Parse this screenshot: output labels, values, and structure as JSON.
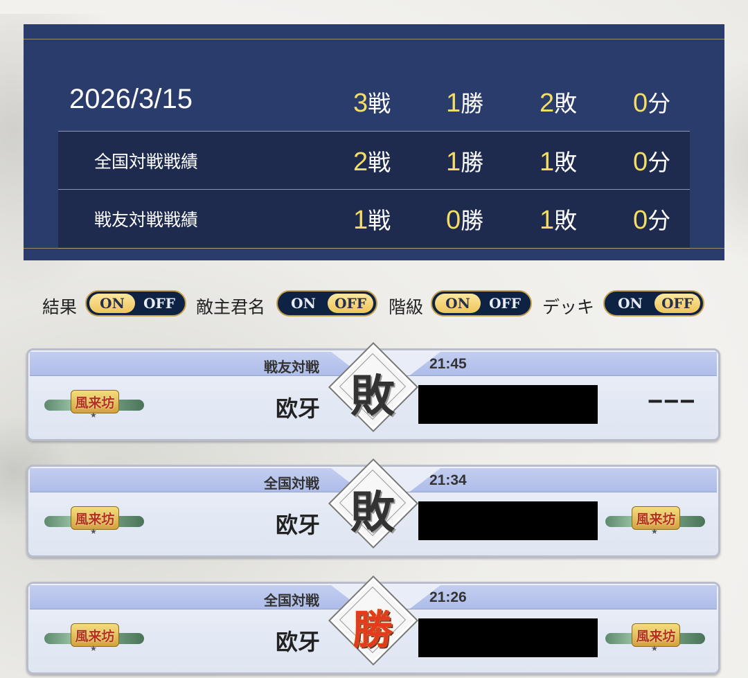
{
  "summary": {
    "date": "2026/3/15",
    "total": {
      "battles": "3",
      "battles_unit": "戦",
      "wins": "1",
      "wins_unit": "勝",
      "losses": "2",
      "losses_unit": "敗",
      "draws": "0",
      "draws_unit": "分"
    },
    "national": {
      "label": "全国対戦戦績",
      "battles": "2",
      "battles_unit": "戦",
      "wins": "1",
      "wins_unit": "勝",
      "losses": "1",
      "losses_unit": "敗",
      "draws": "0",
      "draws_unit": "分"
    },
    "friend": {
      "label": "戦友対戦戦績",
      "battles": "1",
      "battles_unit": "戦",
      "wins": "0",
      "wins_unit": "勝",
      "losses": "1",
      "losses_unit": "敗",
      "draws": "0",
      "draws_unit": "分"
    }
  },
  "filters": {
    "on_label": "ON",
    "off_label": "OFF",
    "items": [
      {
        "label": "結果",
        "state": "ON"
      },
      {
        "label": "敵主君名",
        "state": "OFF"
      },
      {
        "label": "階級",
        "state": "ON"
      },
      {
        "label": "デッキ",
        "state": "OFF"
      }
    ]
  },
  "battles": [
    {
      "mode": "戦友対戦",
      "time": "21:45",
      "player": "欧牙",
      "result": "敗",
      "result_type": "lose",
      "my_rank": "風来坊",
      "opp_rank": "",
      "opp_rank_text": "−−−"
    },
    {
      "mode": "全国対戦",
      "time": "21:34",
      "player": "欧牙",
      "result": "敗",
      "result_type": "lose",
      "my_rank": "風来坊",
      "opp_rank": "風来坊",
      "opp_rank_text": ""
    },
    {
      "mode": "全国対戦",
      "time": "21:26",
      "player": "欧牙",
      "result": "勝",
      "result_type": "win",
      "my_rank": "風来坊",
      "opp_rank": "風来坊",
      "opp_rank_text": ""
    }
  ],
  "colors": {
    "panel": "#2a3c6c",
    "highlight_number": "#f4de63",
    "win": "#e23b1e",
    "lose": "#333333"
  },
  "icons": {
    "rank_badge": "rank-emblem-icon",
    "result_mark": "result-diamond-icon"
  }
}
